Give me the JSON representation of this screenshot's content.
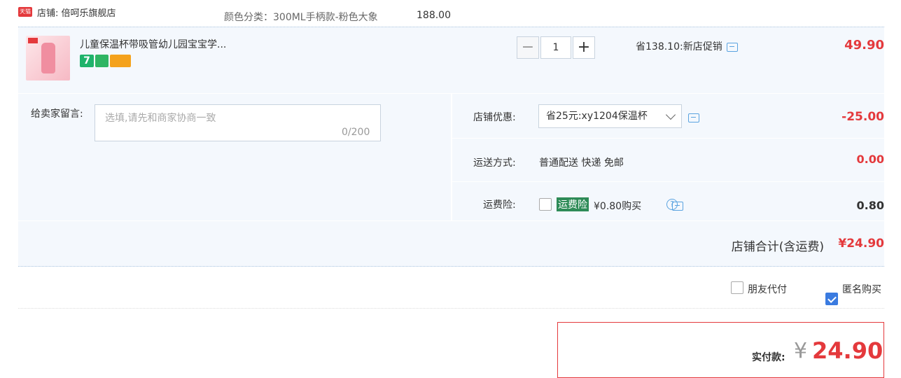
{
  "shop": {
    "badge": "天猫",
    "label": "店铺: 倍呵乐旗舰店"
  },
  "item": {
    "title": "儿童保温杯带吸管幼儿园宝宝学...",
    "sku": "颜色分类：300ML手柄款-粉色大象",
    "price": "188.00",
    "qty": "1",
    "promo": "省138.10:新店促销",
    "total": "49.90",
    "badge_7": "7"
  },
  "message": {
    "label": "给卖家留言:",
    "placeholder": "选填,请先和商家协商一致",
    "count": "0/200"
  },
  "coupon": {
    "label": "店铺优惠:",
    "selected": "省25元:xy1204保温杯",
    "value": "-25.00"
  },
  "shipping": {
    "label": "运送方式:",
    "method": "普通配送 快递 免邮",
    "value": "0.00"
  },
  "insurance": {
    "label": "运费险:",
    "tag": "运费险",
    "price": "¥0.80购买",
    "help": "?",
    "value": "0.80"
  },
  "shop_total": {
    "label": "店铺合计(含运费)",
    "value": "¥24.90"
  },
  "options": {
    "friend_pay": "朋友代付",
    "anonymous": "匿名购买"
  },
  "payment": {
    "label": "实付款:",
    "currency": "¥",
    "value": "24.90"
  }
}
